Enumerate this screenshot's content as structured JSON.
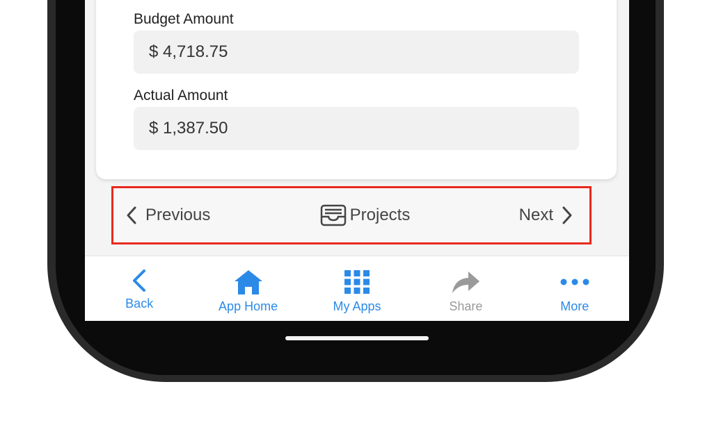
{
  "form": {
    "budget_label": "Budget Amount",
    "budget_value": "$ 4,718.75",
    "actual_label": "Actual Amount",
    "actual_value": "$ 1,387.50"
  },
  "record_nav": {
    "previous_label": "Previous",
    "projects_label": "Projects",
    "next_label": "Next",
    "highlight_color": "#e8281f"
  },
  "tabbar": {
    "accent": "#2b8ae8",
    "items": [
      {
        "label": "Back",
        "icon": "chevron-left-icon"
      },
      {
        "label": "App Home",
        "icon": "home-icon"
      },
      {
        "label": "My Apps",
        "icon": "grid-icon"
      },
      {
        "label": "Share",
        "icon": "share-arrow-icon",
        "disabled": true
      },
      {
        "label": "More",
        "icon": "more-dots-icon"
      }
    ]
  }
}
